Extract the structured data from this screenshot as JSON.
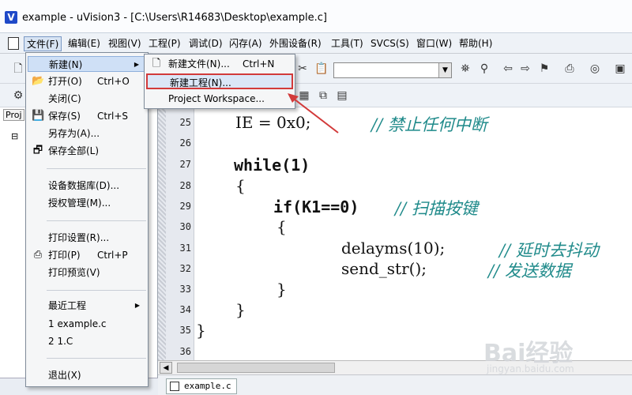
{
  "window": {
    "title": "example  - uVision3 - [C:\\Users\\R14683\\Desktop\\example.c]",
    "icon": "uvision-app-icon"
  },
  "menubar": {
    "items": [
      "文件(F)",
      "编辑(E)",
      "视图(V)",
      "工程(P)",
      "调试(D)",
      "闪存(A)",
      "外围设备(R)",
      "工具(T)",
      "SVCS(S)",
      "窗口(W)",
      "帮助(H)"
    ]
  },
  "toolbar": {
    "combo_value": ""
  },
  "left_panel": {
    "tab_label": "Proj",
    "tree_toggle": "⊟"
  },
  "file_menu": {
    "items": [
      {
        "label": "新建(N)",
        "shortcut": "",
        "submenu": true,
        "icon": ""
      },
      {
        "label": "打开(O)",
        "shortcut": "Ctrl+O",
        "icon": "folder-open-icon"
      },
      {
        "label": "关闭(C)",
        "shortcut": "",
        "icon": ""
      },
      {
        "label": "保存(S)",
        "shortcut": "Ctrl+S",
        "icon": "floppy-disk-icon"
      },
      {
        "label": "另存为(A)...",
        "shortcut": "",
        "icon": ""
      },
      {
        "label": "保存全部(L)",
        "shortcut": "",
        "icon": "save-all-icon"
      },
      {
        "label": "设备数据库(D)...",
        "shortcut": "",
        "icon": ""
      },
      {
        "label": "授权管理(M)...",
        "shortcut": "",
        "icon": ""
      },
      {
        "label": "打印设置(R)...",
        "shortcut": "",
        "icon": ""
      },
      {
        "label": "打印(P)",
        "shortcut": "Ctrl+P",
        "icon": "printer-icon"
      },
      {
        "label": "打印预览(V)",
        "shortcut": "",
        "icon": ""
      },
      {
        "label": "最近工程",
        "shortcut": "",
        "submenu": true,
        "icon": ""
      },
      {
        "label": "1 example.c",
        "shortcut": "",
        "icon": ""
      },
      {
        "label": "2 1.C",
        "shortcut": "",
        "icon": ""
      },
      {
        "label": "退出(X)",
        "shortcut": "",
        "icon": ""
      }
    ]
  },
  "new_submenu": {
    "items": [
      {
        "label": "新建文件(N)...",
        "shortcut": "Ctrl+N",
        "icon": "new-file-icon"
      },
      {
        "label": "新建工程(N)...",
        "shortcut": "",
        "icon": ""
      },
      {
        "label": "Project Workspace...",
        "shortcut": "",
        "icon": ""
      }
    ]
  },
  "editor": {
    "lines": [
      {
        "num": "25",
        "code": "IE = 0x0;",
        "comment": "// 禁止任何中断"
      },
      {
        "num": "26",
        "code": "",
        "comment": ""
      },
      {
        "num": "27",
        "code": "while(1)",
        "comment": ""
      },
      {
        "num": "28",
        "code": "{",
        "comment": ""
      },
      {
        "num": "29",
        "code": "if(K1==0)",
        "comment": "// 扫描按键"
      },
      {
        "num": "30",
        "code": "{",
        "comment": ""
      },
      {
        "num": "31",
        "code": "delayms(10);",
        "comment": "// 延时去抖动"
      },
      {
        "num": "32",
        "code": "send_str();",
        "comment": "// 发送数据"
      },
      {
        "num": "33",
        "code": "}",
        "comment": ""
      },
      {
        "num": "34",
        "code": "}",
        "comment": ""
      },
      {
        "num": "35",
        "code": "}",
        "comment": ""
      },
      {
        "num": "36",
        "code": "",
        "comment": ""
      }
    ],
    "file_tab": "example.c"
  },
  "watermark": {
    "brand": "Bai经验",
    "url": "jingyan.baidu.com"
  },
  "colors": {
    "highlight_outline": "#d23a3a",
    "comment": "#1f8a8a",
    "menu_highlight": "#cfe0f6"
  }
}
